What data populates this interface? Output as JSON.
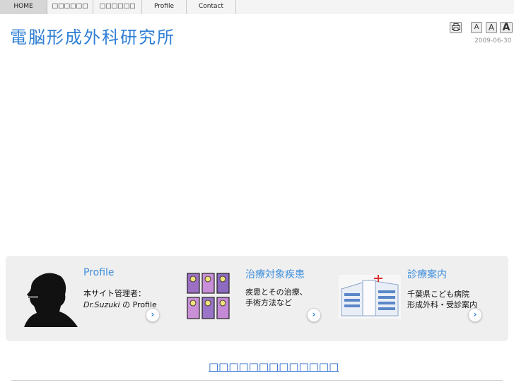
{
  "nav": {
    "items": [
      {
        "label": "HOME"
      },
      {
        "label": "□□□□□□"
      },
      {
        "label": "□□□□□□"
      },
      {
        "label": "Profile"
      },
      {
        "label": "Contact"
      }
    ]
  },
  "header": {
    "title": "電脳形成外科研究所",
    "date": "2009-06-30",
    "font_buttons": [
      "A",
      "A",
      "A"
    ],
    "print_icon": "printer-icon"
  },
  "cards": [
    {
      "title": "Profile",
      "line1": "本サイト管理者：",
      "line2_italic": "Dr.Suzuki",
      "line2_rest": " の Profile",
      "arrow": "›"
    },
    {
      "title": "治療対象疾患",
      "line1": "疾患とその治療、",
      "line2": "手術方法など",
      "arrow": "›"
    },
    {
      "title": "診療案内",
      "line1": "千葉県こども病院",
      "line2": "形成外科・受診案内",
      "arrow": "›"
    }
  ],
  "footer": {
    "title": "□□□□□□□□□□□□□"
  },
  "colors": {
    "accent": "#2f7fd6",
    "link": "#2266cc"
  }
}
